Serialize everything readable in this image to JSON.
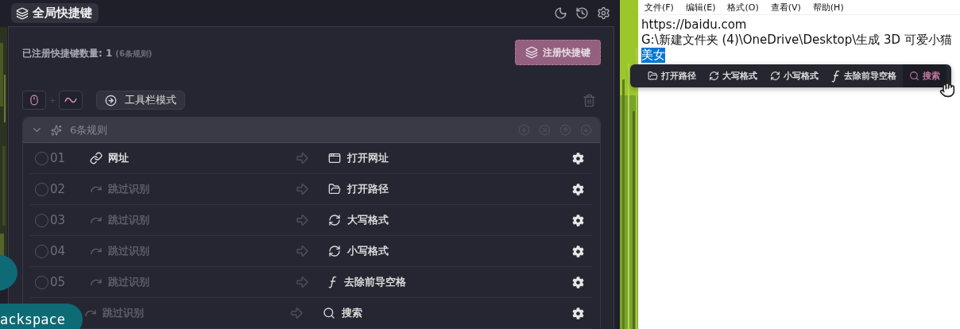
{
  "app": {
    "title": "全局快捷键",
    "registered": {
      "label": "已注册快捷键数量: 1",
      "note": "(6条规则)"
    },
    "register_button": "注册快捷键",
    "trigger": {
      "plus": "+"
    },
    "mode_button": "工具栏模式",
    "group": {
      "title": "6条规则",
      "expanded": true,
      "rules": [
        {
          "number": "01",
          "checked": false,
          "kind": "url",
          "source": "网址",
          "action": {
            "label": "打开网址",
            "kind": "window"
          }
        },
        {
          "number": "02",
          "checked": false,
          "kind": "skip",
          "source": "跳过识别",
          "action": {
            "label": "打开路径",
            "kind": "folder"
          }
        },
        {
          "number": "03",
          "checked": false,
          "kind": "skip",
          "source": "跳过识别",
          "action": {
            "label": "大写格式",
            "kind": "convert"
          }
        },
        {
          "number": "04",
          "checked": false,
          "kind": "skip",
          "source": "跳过识别",
          "action": {
            "label": "小写格式",
            "kind": "convert"
          }
        },
        {
          "number": "05",
          "checked": false,
          "kind": "skip",
          "source": "跳过识别",
          "action": {
            "label": "去除前导空格",
            "kind": "function"
          }
        },
        {
          "kind": "skip",
          "source": "跳过识别",
          "action": {
            "label": "搜索",
            "kind": "search"
          }
        }
      ]
    }
  },
  "notepad": {
    "menu": [
      "文件(F)",
      "编辑(E)",
      "格式(O)",
      "查看(V)",
      "帮助(H)"
    ],
    "lines": [
      {
        "text": "https://baidu.com",
        "selected": false
      },
      {
        "text": "G:\\新建文件夹 (4)\\OneDrive\\Desktop\\生成 3D 可爱小猫",
        "selected": false
      },
      {
        "text": "美女",
        "selected": true
      }
    ]
  },
  "popup_toolbar": {
    "items": [
      {
        "label": "打开路径",
        "kind": "folder",
        "hovered": false
      },
      {
        "label": "大写格式",
        "kind": "convert",
        "hovered": false
      },
      {
        "label": "小写格式",
        "kind": "convert",
        "hovered": false
      },
      {
        "label": "去除前导空格",
        "kind": "function",
        "hovered": false
      },
      {
        "label": "搜索",
        "kind": "search",
        "hovered": true
      }
    ]
  },
  "key_bubbles": [
    {
      "label": "ackspace"
    }
  ]
}
